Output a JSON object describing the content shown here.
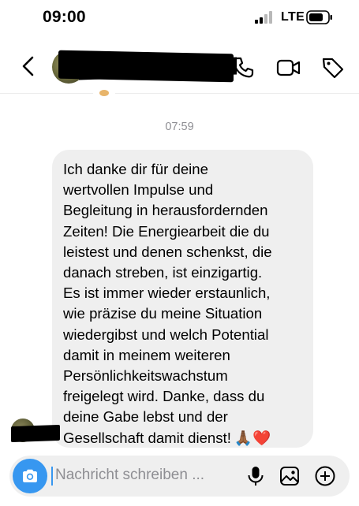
{
  "status_bar": {
    "time": "09:00",
    "network": "LTE",
    "icons": [
      "signal-icon",
      "battery-icon"
    ]
  },
  "header": {
    "icons": [
      "back-icon",
      "phone-icon",
      "video-icon",
      "tag-icon"
    ]
  },
  "conversation": {
    "timestamp": "07:59",
    "message": {
      "text": "Ich danke dir für deine\nwertvollen Impulse und\nBegleitung in herausfordernden\nZeiten! Die Energiearbeit die du\nleistest und denen schenkst, die\ndanach streben, ist einzigartig.\nEs ist immer wieder erstaunlich,\nwie präzise du meine Situation\nwiedergibst und welch Potential\ndamit in meinem weiteren\nPersönlichkeitswachstum\nfreigelegt wird. Danke, dass du\ndeine Gabe lebst und der\nGesellschaft damit dienst!",
      "emoji": "🙏🏾❤️"
    }
  },
  "composer": {
    "placeholder": "Nachricht schreiben ...",
    "accent_color": "#3797f0",
    "icons": [
      "camera-icon",
      "microphone-icon",
      "image-icon",
      "add-icon"
    ]
  }
}
